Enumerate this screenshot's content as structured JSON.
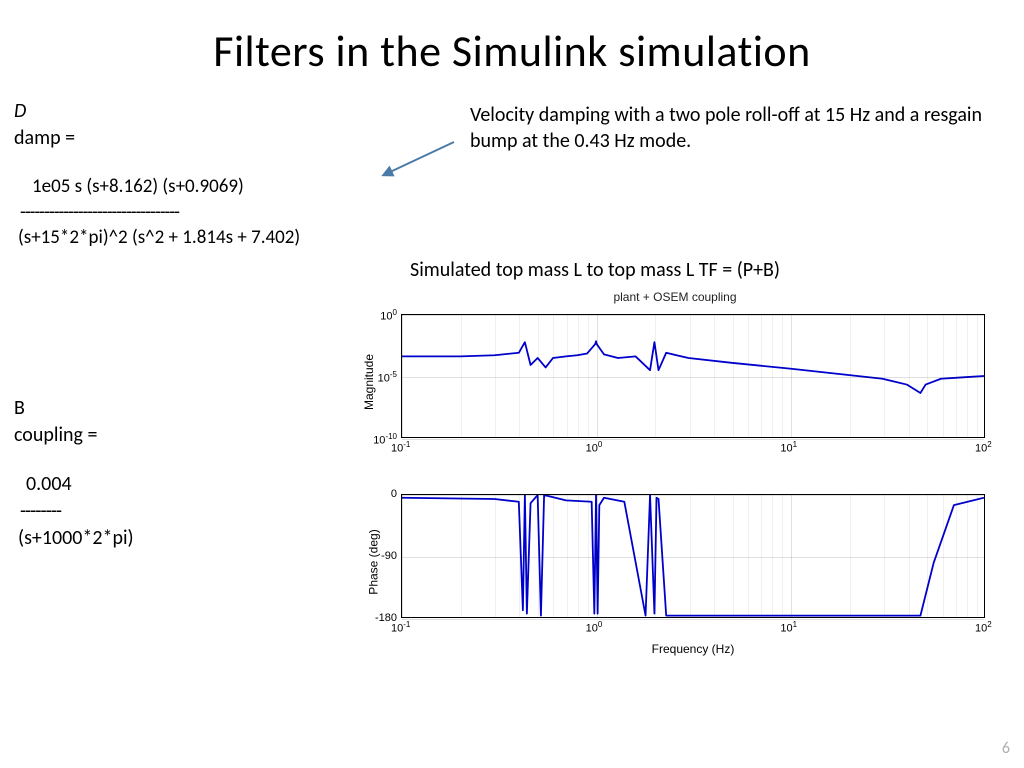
{
  "title": "Filters in the Simulink simulation",
  "left": {
    "D_label": "D",
    "damp_label": "damp =",
    "damp_num": "1e05 s (s+8.162) (s+0.9069)",
    "damp_bar": "---------------------------------",
    "damp_den": "(s+15*2*pi)^2 (s^2 + 1.814s + 7.402)",
    "B_label": "B",
    "coupling_label": "coupling =",
    "coup_num": "0.004",
    "coup_bar": "--------",
    "coup_den": "(s+1000*2*pi)"
  },
  "annotation": "Velocity damping with a two pole roll-off at 15 Hz and a resgain bump at the 0.43 Hz mode.",
  "tf_label": "Simulated top mass L to top mass L TF = (P+B)",
  "pagenum": "6",
  "chart_title": "plant + OSEM coupling",
  "chart_data": [
    {
      "type": "line",
      "title": "plant + OSEM coupling (Magnitude)",
      "xlabel": "Frequency (Hz)",
      "ylabel": "Magnitude",
      "xscale": "log",
      "yscale": "log",
      "xlim": [
        0.1,
        100
      ],
      "ylim": [
        1e-10,
        1
      ],
      "xticks": [
        0.1,
        1,
        10,
        100
      ],
      "yticks": [
        1e-10,
        1e-05,
        1
      ],
      "series": [
        {
          "name": "plant + OSEM coupling",
          "color": "#0000cc",
          "freq_hz": [
            0.1,
            0.2,
            0.3,
            0.4,
            0.43,
            0.46,
            0.5,
            0.55,
            0.6,
            0.7,
            0.8,
            0.9,
            0.99,
            1.0,
            1.01,
            1.1,
            1.3,
            1.6,
            1.9,
            2.0,
            2.1,
            2.3,
            2.6,
            3.0,
            5.0,
            10.0,
            20.0,
            30.0,
            40.0,
            47.0,
            50.0,
            60.0,
            80.0,
            100.0
          ],
          "magnitude": [
            0.0004,
            0.0004,
            0.0005,
            0.0008,
            0.006,
            8e-05,
            0.0003,
            5e-05,
            0.0003,
            0.0004,
            0.0005,
            0.0007,
            0.004,
            0.007,
            0.004,
            0.0006,
            0.0003,
            0.0004,
            3e-05,
            0.006,
            3e-05,
            0.0008,
            0.0005,
            0.0003,
            0.00012,
            4e-05,
            1.2e-05,
            6e-06,
            2e-06,
            4e-07,
            2e-06,
            6e-06,
            8e-06,
            1e-05
          ]
        }
      ]
    },
    {
      "type": "line",
      "title": "Phase",
      "xlabel": "Frequency (Hz)",
      "ylabel": "Phase (deg)",
      "xscale": "log",
      "yscale": "linear",
      "xlim": [
        0.1,
        100
      ],
      "ylim": [
        -180,
        0
      ],
      "xticks": [
        0.1,
        1,
        10,
        100
      ],
      "yticks": [
        -180,
        -90,
        0
      ],
      "series": [
        {
          "name": "Phase",
          "color": "#0000cc",
          "freq_hz": [
            0.1,
            0.3,
            0.4,
            0.42,
            0.43,
            0.44,
            0.46,
            0.5,
            0.52,
            0.54,
            0.7,
            0.95,
            0.98,
            1.0,
            1.02,
            1.04,
            1.1,
            1.4,
            1.8,
            1.9,
            2.0,
            2.05,
            2.1,
            2.3,
            3.0,
            5.0,
            10.0,
            30.0,
            40.0,
            47.0,
            55.0,
            70.0,
            100.0
          ],
          "phase_deg": [
            -4,
            -6,
            -10,
            -170,
            0,
            -175,
            -12,
            0,
            -178,
            0,
            -8,
            -10,
            -175,
            0,
            -175,
            -15,
            -4,
            -10,
            -178,
            0,
            -175,
            -4,
            -6,
            -178,
            -178,
            -178,
            -178,
            -178,
            -178,
            -178,
            -100,
            -15,
            -4
          ]
        }
      ]
    }
  ]
}
